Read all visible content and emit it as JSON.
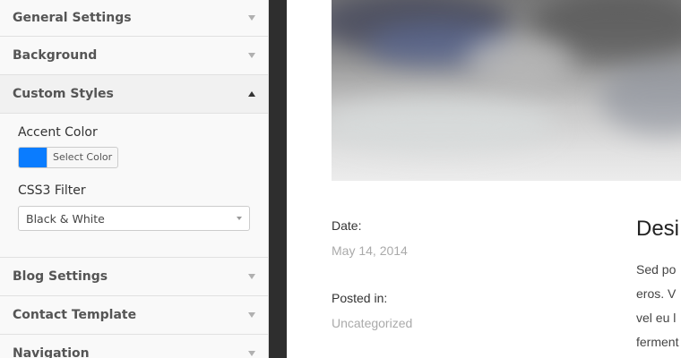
{
  "sidebar": {
    "sections": [
      {
        "title": "General Settings",
        "state": "collapsed"
      },
      {
        "title": "Background",
        "state": "collapsed"
      },
      {
        "title": "Custom Styles",
        "state": "expanded"
      },
      {
        "title": "Blog Settings",
        "state": "collapsed"
      },
      {
        "title": "Contact Template",
        "state": "collapsed"
      },
      {
        "title": "Navigation",
        "state": "collapsed"
      }
    ],
    "custom_styles": {
      "accent_color_label": "Accent Color",
      "accent_color_value": "#0a7cff",
      "select_color_label": "Select Color",
      "filter_label": "CSS3 Filter",
      "filter_value": "Black & White"
    }
  },
  "preview": {
    "date_label": "Date:",
    "date_value": "May 14, 2014",
    "posted_in_label": "Posted in:",
    "posted_in_value": "Uncategorized",
    "post_title": "Desi",
    "excerpt_lines": [
      "Sed po",
      "eros. V",
      "vel eu l",
      "ferment"
    ]
  },
  "colors": {
    "gutter": "#2e2e2e",
    "accent": "#0a7cff"
  }
}
